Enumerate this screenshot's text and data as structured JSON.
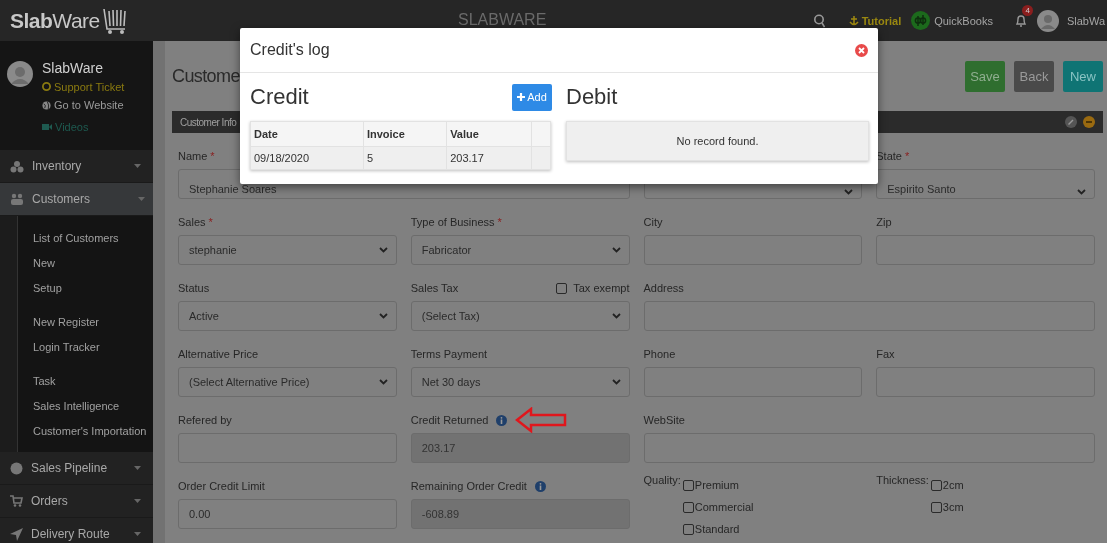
{
  "topbar": {
    "logo": "**Slab**Ware",
    "center_title": "SLABWARE",
    "tutorial": "Tutorial",
    "quickbooks": "QuickBooks",
    "notification_count": "4",
    "user": "SlabWa"
  },
  "sidebar": {
    "profile": {
      "name": "SlabWare",
      "links": [
        {
          "kind": "support",
          "label": "Support Ticket"
        },
        {
          "kind": "website",
          "label": "Go to Website"
        },
        {
          "kind": "videos",
          "label": "Videos"
        }
      ]
    },
    "items": [
      {
        "kind": "inventory",
        "label": "Inventory",
        "selected": false
      },
      {
        "kind": "customers",
        "label": "Customers",
        "selected": true,
        "expanded": true,
        "groups": [
          {
            "children": [
              {
                "label": "List of Customers"
              },
              {
                "label": "New"
              },
              {
                "label": "Setup"
              }
            ]
          },
          {
            "children": [
              {
                "label": "New Register"
              },
              {
                "label": "Login Tracker"
              }
            ]
          },
          {
            "children": [
              {
                "label": "Task"
              },
              {
                "label": "Sales Intelligence"
              },
              {
                "label": "Customer's Importation"
              }
            ]
          }
        ]
      },
      {
        "kind": "pipeline",
        "label": "Sales Pipeline",
        "selected": false
      },
      {
        "kind": "orders",
        "label": "Orders",
        "selected": false
      },
      {
        "kind": "route",
        "label": "Delivery Route",
        "selected": false
      }
    ]
  },
  "page": {
    "title": "Custome",
    "buttons": [
      {
        "kind": "save",
        "label": "Save"
      },
      {
        "kind": "back",
        "label": "Back"
      },
      {
        "kind": "new",
        "label": "New"
      }
    ],
    "panel": {
      "title": "Customer Info",
      "rows": [
        {
          "fields": [
            {
              "label": "Name",
              "mark": "*",
              "kind": "text",
              "value": "Stephanie Soares",
              "wide": true
            },
            {
              "kind": "select"
            },
            {
              "label": "State",
              "mark": "*",
              "kind": "select",
              "value": "Espirito Santo"
            }
          ]
        },
        {
          "fields": [
            {
              "label": "Sales",
              "mark": "*",
              "kind": "select",
              "value": "stephanie"
            },
            {
              "label": "Type of Business",
              "mark": "*",
              "kind": "select",
              "value": "Fabricator"
            },
            {
              "label": "City",
              "kind": "text"
            },
            {
              "label": "Zip",
              "kind": "text"
            }
          ]
        },
        {
          "fields": [
            {
              "label": "Status",
              "kind": "select",
              "value": "Active"
            },
            {
              "label": "Sales Tax",
              "kind": "select",
              "value": "(Select Tax)",
              "option": {
                "label": "Tax exempt",
                "checked": false
              }
            },
            {
              "label": "Address",
              "kind": "text",
              "wide": true
            }
          ]
        },
        {
          "fields": [
            {
              "label": "Alternative Price",
              "kind": "select",
              "value": "(Select Alternative Price)"
            },
            {
              "label": "Terms Payment",
              "kind": "select",
              "value": "Net 30 days"
            },
            {
              "label": "Phone",
              "kind": "text"
            },
            {
              "label": "Fax",
              "kind": "text"
            }
          ]
        },
        {
          "fields": [
            {
              "label": "Refered by",
              "kind": "text"
            },
            {
              "label": "Credit Returned",
              "kind": "text",
              "value": "203.17",
              "disabled": true,
              "info": true,
              "pointer_arrow": true
            },
            {
              "label": "WebSite",
              "kind": "text",
              "wide": true
            }
          ]
        },
        {
          "fields": [
            {
              "label": "Order Credit Limit",
              "kind": "text",
              "value": "0.00"
            },
            {
              "label": "Remaining Order Credit",
              "kind": "text",
              "value": "-608.89",
              "disabled": true,
              "info": true
            },
            {
              "label": "Quality:",
              "kind": "checks",
              "options": [
                {
                  "label": "Premium",
                  "checked": false
                },
                {
                  "label": "Commercial",
                  "checked": false
                },
                {
                  "label": "Standard",
                  "checked": false
                }
              ]
            },
            {
              "label": "Thickness:",
              "kind": "checks",
              "options": [
                {
                  "label": "2cm",
                  "checked": false
                },
                {
                  "label": "3cm",
                  "checked": false
                }
              ]
            }
          ]
        }
      ]
    }
  },
  "modal": {
    "title": "Credit's log",
    "credit": {
      "heading": "Credit",
      "add_button": "Add",
      "columns": [
        "Date",
        "Invoice",
        "Value"
      ],
      "rows": [
        [
          "09/18/2020",
          "5",
          "203.17"
        ]
      ]
    },
    "debit": {
      "heading": "Debit",
      "empty_text": "No record found."
    }
  }
}
